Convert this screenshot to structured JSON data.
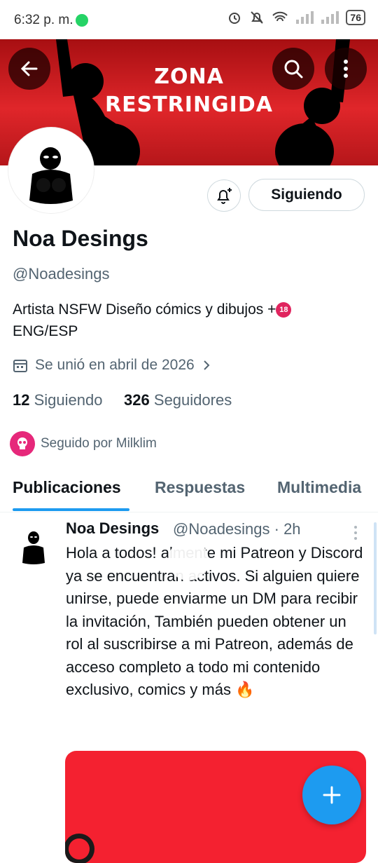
{
  "status_bar": {
    "time": "6:32 p. m.",
    "battery": "76"
  },
  "banner": {
    "line1": "ZONA",
    "line2": "RESTRINGIDA"
  },
  "profile": {
    "follow_label": "Siguiendo",
    "name": "Noa Desings",
    "handle": "@Noadesings",
    "bio": "Artista NSFW Diseño cómics y dibujos +",
    "bio_line2": "ENG/ESP",
    "badge": "18",
    "joined": "Se unió en abril de 2026",
    "following_count": "12",
    "following_label": "Siguiendo",
    "followers_count": "326",
    "followers_label": "Seguidores",
    "followed_by": "Seguido por Milklim"
  },
  "tabs": [
    "Publicaciones",
    "Respuestas",
    "Multimedia"
  ],
  "post": {
    "name": "Noa Desings",
    "handle_time": "@Noadesings · 2h",
    "text": "Hola a todos!    almente mi Patreon y Discord ya se encuentran activos. Si alguien quiere unirse, puede enviarme un DM para recibir la invitación, También pueden obtener un rol al suscribirse a mi Patreon, además de acceso completo a todo mi contenido exclusivo, comics y más 🔥"
  },
  "colors": {
    "accent": "#1d9bf0",
    "banner_red": "#d21f24",
    "secondary_text": "#536471"
  },
  "icons": [
    "back-arrow-icon",
    "search-icon",
    "more-vertical-icon",
    "bell-plus-icon",
    "calendar-icon",
    "chevron-right-icon",
    "plus-icon"
  ]
}
